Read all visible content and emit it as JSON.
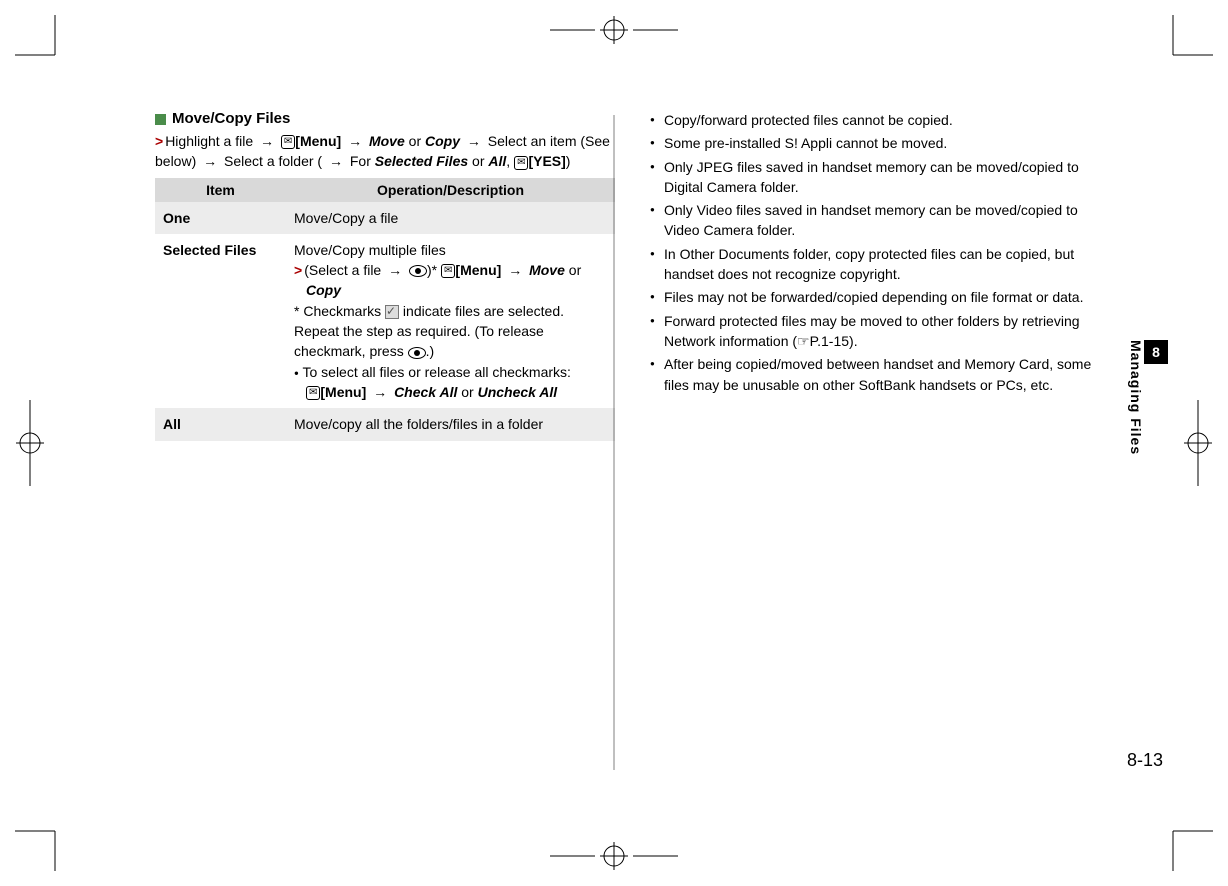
{
  "section": {
    "title": "Move/Copy Files",
    "instruction_parts": {
      "p1": "Highlight a file",
      "menu": "[Menu]",
      "move": "Move",
      "or1": " or ",
      "copy": "Copy",
      "p2": "Select an item (See below)",
      "p3": "Select a folder (",
      "forText": " For ",
      "selectedFiles": "Selected Files",
      "or2": " or ",
      "all": "All",
      "comma": ", ",
      "yes": "[YES]",
      "close": ")"
    }
  },
  "table": {
    "headers": {
      "item": "Item",
      "op": "Operation/Description"
    },
    "rows": {
      "one": {
        "item": "One",
        "op": "Move/Copy a file"
      },
      "selected": {
        "item": "Selected Files",
        "line1": "Move/Copy multiple files",
        "sel_a": "(Select a file",
        "sel_b": ")*",
        "menu": "[Menu]",
        "move": "Move",
        "or": " or ",
        "copy": "Copy",
        "note_a": "* Checkmarks ",
        "note_b": " indicate files are selected. Repeat the step as required. (To release checkmark, press ",
        "note_c": ".)",
        "bullet_a": "To select all files or release all checkmarks:",
        "bullet_menu": "[Menu]",
        "checkAll": "Check All",
        "or2": " or ",
        "uncheckAll": "Uncheck All"
      },
      "all": {
        "item": "All",
        "op": "Move/copy all the folders/files in a folder"
      }
    }
  },
  "notes": [
    "Copy/forward protected files cannot be copied.",
    "Some pre-installed S! Appli cannot be moved.",
    "Only JPEG files saved in handset memory can be moved/copied to Digital Camera folder.",
    "Only Video files saved in handset memory can be moved/copied to Video Camera folder.",
    "In Other Documents folder, copy protected files can be copied, but handset does not recognize copyright.",
    "Files may not be forwarded/copied depending on file format or data.",
    "Forward protected files may be moved to other folders by retrieving Network information (☞P.1-15).",
    "After being copied/moved between handset and Memory Card, some files may be unusable on other SoftBank handsets or PCs, etc."
  ],
  "sideTab": {
    "chapter": "8",
    "label": "Managing Files"
  },
  "pageNumber": "8-13",
  "glyphs": {
    "arrow": "→",
    "chevron": ">",
    "bullet": "●",
    "envelope": "✉"
  }
}
